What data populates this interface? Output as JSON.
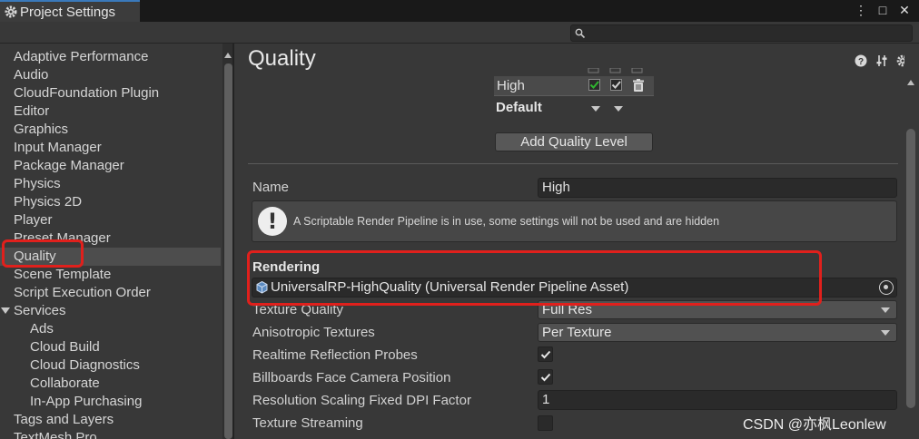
{
  "window": {
    "tab_title": "Project Settings",
    "controls": [
      "⋮",
      "□",
      "✕"
    ]
  },
  "search": {
    "placeholder": ""
  },
  "sidebar": {
    "items": [
      {
        "label": "Adaptive Performance"
      },
      {
        "label": "Audio"
      },
      {
        "label": "CloudFoundation Plugin"
      },
      {
        "label": "Editor"
      },
      {
        "label": "Graphics"
      },
      {
        "label": "Input Manager"
      },
      {
        "label": "Package Manager"
      },
      {
        "label": "Physics"
      },
      {
        "label": "Physics 2D"
      },
      {
        "label": "Player"
      },
      {
        "label": "Preset Manager"
      },
      {
        "label": "Quality",
        "selected": true
      },
      {
        "label": "Scene Template"
      },
      {
        "label": "Script Execution Order"
      },
      {
        "label": "Services",
        "expanded": true
      },
      {
        "label": "Ads",
        "indent": 1
      },
      {
        "label": "Cloud Build",
        "indent": 1
      },
      {
        "label": "Cloud Diagnostics",
        "indent": 1
      },
      {
        "label": "Collaborate",
        "indent": 1
      },
      {
        "label": "In-App Purchasing",
        "indent": 1
      },
      {
        "label": "Tags and Layers"
      },
      {
        "label": "TextMesh Pro"
      }
    ]
  },
  "main": {
    "title": "Quality",
    "header_icons": [
      "help-icon",
      "preset-icon",
      "gear-icon"
    ],
    "levels": {
      "rows": [
        {
          "label": "High"
        }
      ],
      "default_label": "Default"
    },
    "add_level_label": "Add Quality Level",
    "name_label": "Name",
    "name_value": "High",
    "help_message": "A Scriptable Render Pipeline is in use, some settings will not be used and are hidden",
    "rendering_header": "Rendering",
    "render_pipeline_asset": "UniversalRP-HighQuality (Universal Render Pipeline Asset)",
    "texture_quality_label": "Texture Quality",
    "texture_quality_value": "Full Res",
    "anisotropic_label": "Anisotropic Textures",
    "anisotropic_value": "Per Texture",
    "realtime_probes_label": "Realtime Reflection Probes",
    "realtime_probes_checked": true,
    "billboards_label": "Billboards Face Camera Position",
    "billboards_checked": true,
    "dpi_label": "Resolution Scaling Fixed DPI Factor",
    "dpi_value": "1",
    "streaming_label": "Texture Streaming",
    "streaming_checked": false
  },
  "colors": {
    "highlight": "#e0201c",
    "check_green": "#2fb62f",
    "selected_bg": "#4d4d4d"
  },
  "watermark": "CSDN @亦枫Leonlew"
}
